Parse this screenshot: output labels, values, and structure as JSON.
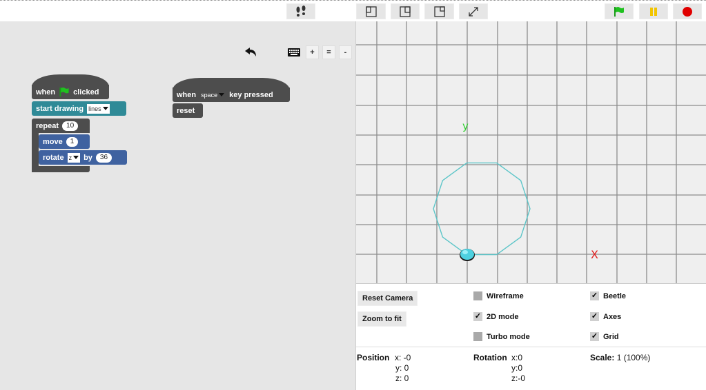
{
  "toolbar": {
    "icons": [
      "footprints-icon",
      "layout-left-icon",
      "layout-right-icon",
      "layout-small-stage-icon",
      "fullscreen-icon",
      "green-flag-icon",
      "pause-icon",
      "stop-icon"
    ]
  },
  "script_tools": {
    "undo": "undo-icon",
    "keyboard": "keyboard-icon",
    "zoom_in": "+",
    "reset_zoom": "=",
    "zoom_out": "-"
  },
  "scripts": {
    "script1": {
      "hat_when": "when",
      "hat_clicked": "clicked",
      "start_drawing": "start drawing",
      "draw_mode": "lines",
      "repeat": "repeat",
      "repeat_count": "10",
      "move": "move",
      "move_steps": "1",
      "rotate": "rotate",
      "rotate_axis": "z",
      "rotate_by": "by",
      "rotate_degrees": "36"
    },
    "script2": {
      "hat_when": "when",
      "key": "space",
      "key_pressed": "key pressed",
      "reset": "reset"
    }
  },
  "stage": {
    "y_axis_label": "y",
    "x_axis_label": "X",
    "axis_y_color": "#2fcf2f",
    "axis_x_color": "#e02020",
    "trail_color": "#5bc5c8",
    "polygon_sides": 10
  },
  "controls": {
    "reset_camera": "Reset Camera",
    "zoom_to_fit": "Zoom to fit",
    "wireframe": {
      "label": "Wireframe",
      "checked": false
    },
    "mode_2d": {
      "label": "2D mode",
      "checked": true
    },
    "turbo": {
      "label": "Turbo mode",
      "checked": false
    },
    "beetle": {
      "label": "Beetle",
      "checked": true
    },
    "axes": {
      "label": "Axes",
      "checked": true
    },
    "grid": {
      "label": "Grid",
      "checked": true
    }
  },
  "info": {
    "position_label": "Position",
    "pos_x": "x: -0",
    "pos_y": "y: 0",
    "pos_z": "z: 0",
    "rotation_label": "Rotation",
    "rot_x": "x:0",
    "rot_y": "y:0",
    "rot_z": "z:-0",
    "scale_label": "Scale:",
    "scale_value": "1 (100%)"
  }
}
